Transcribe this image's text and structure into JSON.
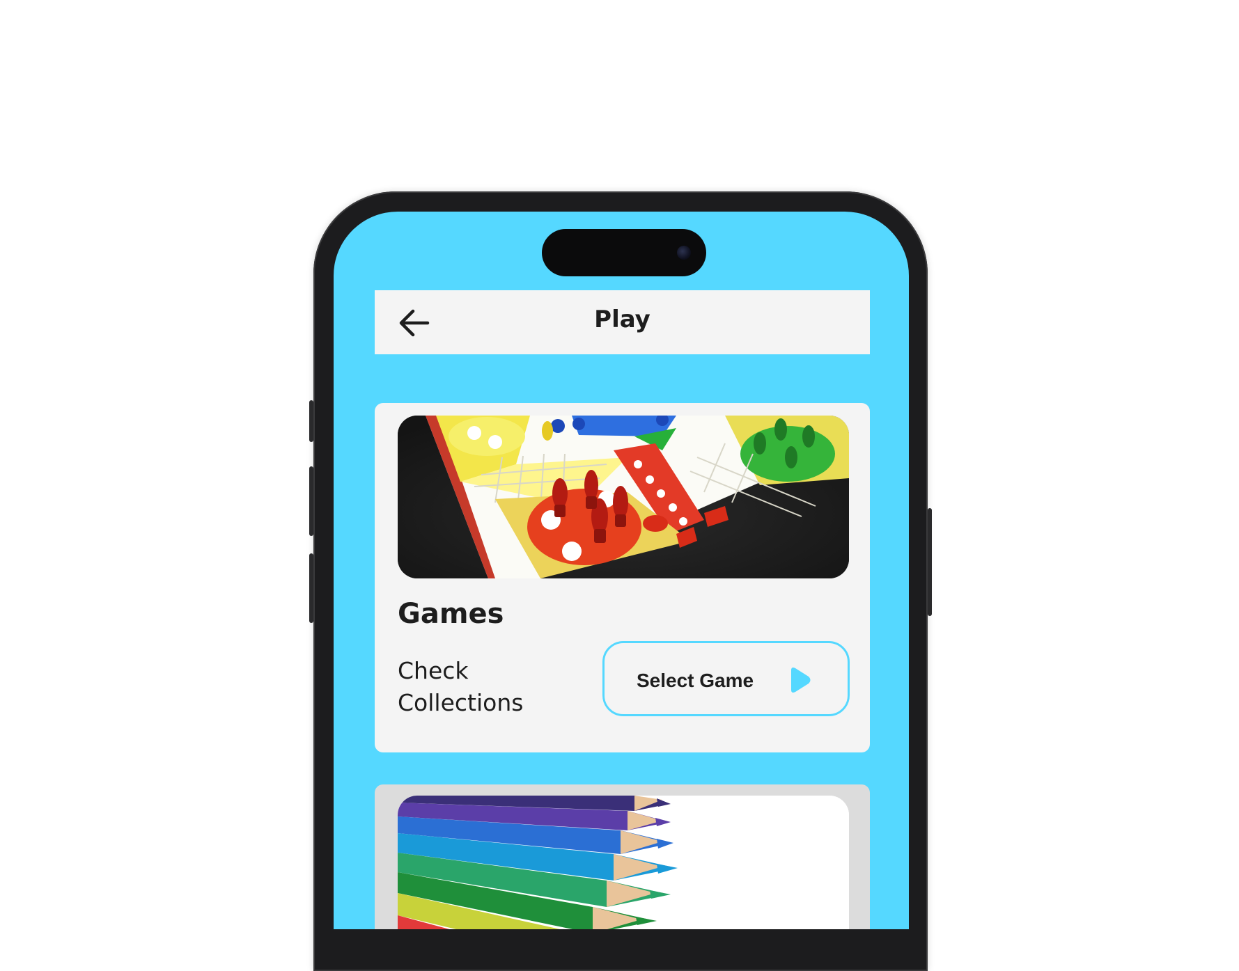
{
  "header": {
    "title": "Play",
    "back_icon": "arrow-left-icon"
  },
  "game_card": {
    "image": "ludo-board-image",
    "title": "Games",
    "subtitle": "Check Collections",
    "button_label": "Select Game",
    "button_icon": "play-icon"
  },
  "second_card": {
    "image": "colored-pencils-image"
  },
  "colors": {
    "screen_background": "#55d8ff",
    "card_background": "#f4f4f4",
    "accent": "#55d8ff",
    "text": "#1d1d1d"
  }
}
